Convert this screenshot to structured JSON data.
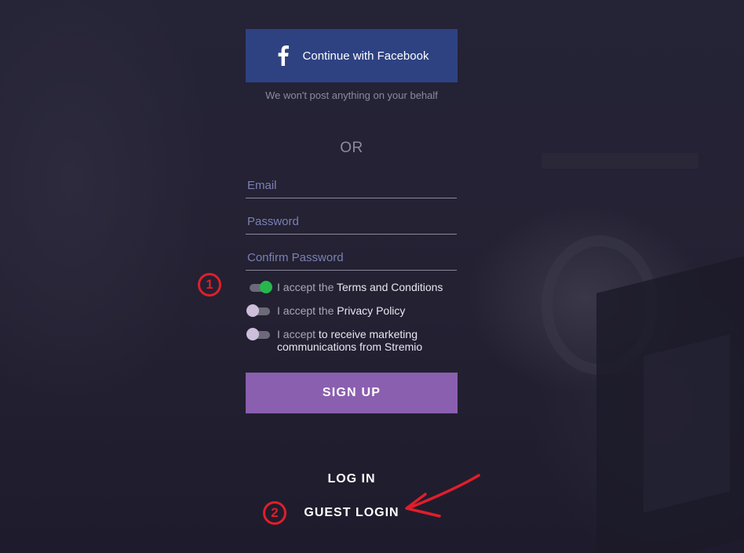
{
  "facebook": {
    "button_label": "Continue with Facebook",
    "icon": "facebook-f-icon",
    "note": "We won't post anything on your behalf",
    "color": "#2e4282"
  },
  "divider": {
    "or_text": "OR"
  },
  "fields": {
    "email": {
      "placeholder": "Email",
      "value": ""
    },
    "password": {
      "placeholder": "Password",
      "value": ""
    },
    "confirm_password": {
      "placeholder": "Confirm Password",
      "value": ""
    }
  },
  "consents": [
    {
      "prefix": "I accept the ",
      "link": "Terms and Conditions",
      "checked": true
    },
    {
      "prefix": "I accept the ",
      "link": "Privacy Policy",
      "checked": false
    },
    {
      "prefix": "I accept ",
      "link": "to receive marketing communications from Stremio",
      "checked": false
    }
  ],
  "actions": {
    "signup_label": "SIGN UP",
    "login_label": "LOG IN",
    "guest_login_label": "GUEST LOGIN",
    "signup_color": "#8b5faf"
  },
  "annotations": {
    "marker_1": "1",
    "marker_2": "2",
    "color": "#e01e2c"
  },
  "colors": {
    "toggle_on": "#26b84c",
    "toggle_off_knob": "#cdbfdc"
  }
}
